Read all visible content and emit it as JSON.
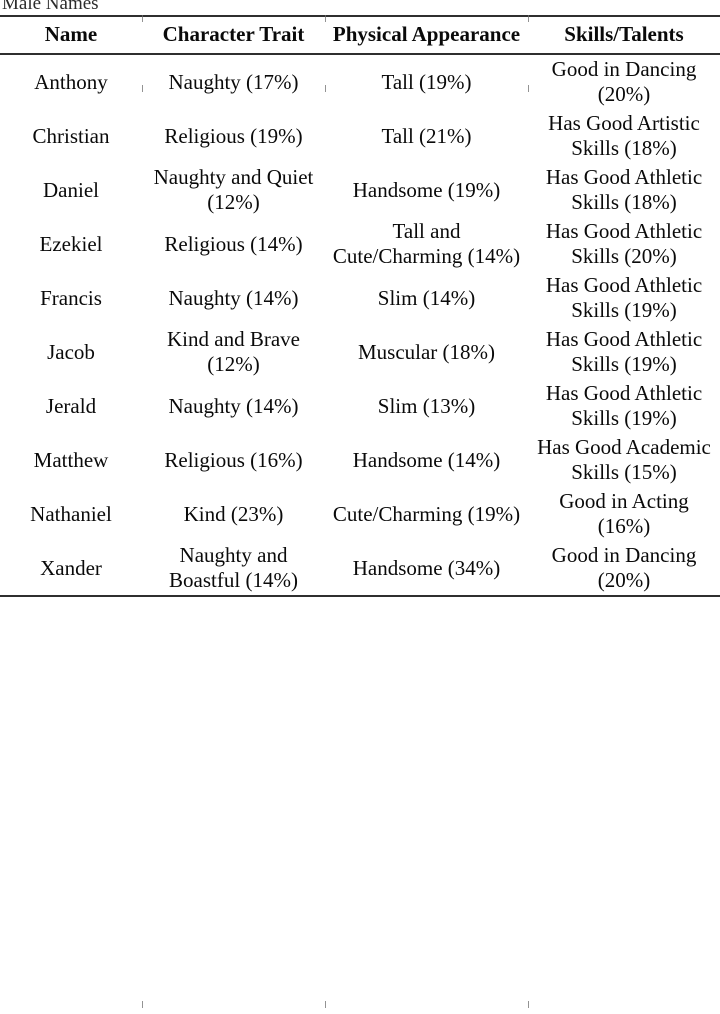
{
  "caption": "Male Names",
  "table": {
    "columns": [
      "Name",
      "Character Trait",
      "Physical Appearance",
      "Skills/Talents"
    ],
    "rows": [
      {
        "name": "Anthony",
        "character_trait": "Naughty (17%)",
        "physical_appearance": "Tall (19%)",
        "skills_talents": "Good in Dancing (20%)"
      },
      {
        "name": "Christian",
        "character_trait": "Religious (19%)",
        "physical_appearance": "Tall (21%)",
        "skills_talents": "Has Good Artistic Skills (18%)"
      },
      {
        "name": "Daniel",
        "character_trait": "Naughty and Quiet (12%)",
        "physical_appearance": "Handsome (19%)",
        "skills_talents": "Has Good Athletic Skills (18%)"
      },
      {
        "name": "Ezekiel",
        "character_trait": "Religious (14%)",
        "physical_appearance": "Tall and Cute/Charming (14%)",
        "skills_talents": "Has Good Athletic Skills (20%)"
      },
      {
        "name": "Francis",
        "character_trait": "Naughty (14%)",
        "physical_appearance": "Slim (14%)",
        "skills_talents": "Has Good Athletic Skills (19%)"
      },
      {
        "name": "Jacob",
        "character_trait": "Kind and Brave (12%)",
        "physical_appearance": "Muscular (18%)",
        "skills_talents": "Has Good Athletic Skills (19%)"
      },
      {
        "name": "Jerald",
        "character_trait": "Naughty (14%)",
        "physical_appearance": "Slim (13%)",
        "skills_talents": "Has Good Athletic Skills (19%)"
      },
      {
        "name": "Matthew",
        "character_trait": "Religious (16%)",
        "physical_appearance": "Handsome (14%)",
        "skills_talents": "Has Good Academic Skills (15%)"
      },
      {
        "name": "Nathaniel",
        "character_trait": "Kind (23%)",
        "physical_appearance": "Cute/Charming (19%)",
        "skills_talents": "Good in Acting (16%)"
      },
      {
        "name": "Xander",
        "character_trait": "Naughty and Boastful (14%)",
        "physical_appearance": "Handsome (34%)",
        "skills_talents": "Good in Dancing (20%)"
      }
    ]
  }
}
